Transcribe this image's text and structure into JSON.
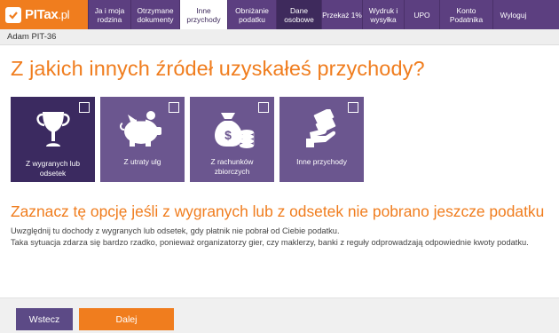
{
  "logo": {
    "text": "PITax",
    "suffix": ".pl"
  },
  "nav": [
    {
      "label": "Ja i moja rodzina",
      "width": 48
    },
    {
      "label": "Otrzymane dokumenty",
      "width": 55
    },
    {
      "label": "Inne przychody",
      "width": 54,
      "state": "active"
    },
    {
      "label": "Obniżanie podatku",
      "width": 55
    },
    {
      "label": "Dane osobowe",
      "width": 51,
      "state": "sel2"
    },
    {
      "label": "Przekaż 1%",
      "width": 46
    },
    {
      "label": "Wydruk i wysyłka",
      "width": 47
    },
    {
      "label": "UPO",
      "width": 40
    },
    {
      "label": "Konto Podatnika",
      "width": 60
    },
    {
      "label": "Wyloguj",
      "width": 46
    }
  ],
  "breadcrumb": "Adam PIT-36",
  "heading": "Z jakich innych źródeł uzyskałeś przychody?",
  "tiles": [
    {
      "label": "Z wygranych lub odsetek",
      "icon": "trophy-icon",
      "selected": true,
      "checked": false
    },
    {
      "label": "Z utraty ulg",
      "icon": "piggy-bank-icon",
      "selected": false,
      "checked": false
    },
    {
      "label": "Z rachunków zbiorczych",
      "icon": "money-bag-icon",
      "selected": false,
      "checked": false
    },
    {
      "label": "Inne przychody",
      "icon": "money-hand-icon",
      "selected": false,
      "checked": false
    }
  ],
  "info": {
    "heading": "Zaznacz tę opcję jeśli z wygranych lub z odsetek nie pobrano jeszcze podatku",
    "line1": "Uwzględnij tu dochody z wygranych lub odsetek, gdy płatnik nie pobrał od Ciebie podatku.",
    "line2": "Taka sytuacja zdarza się bardzo rzadko, ponieważ organizatorzy gier, czy maklerzy, banki z reguły odprowadzają odpowiednie kwoty podatku."
  },
  "buttons": {
    "back": "Wstecz",
    "next": "Dalej"
  },
  "colors": {
    "accent": "#f07d1e",
    "nav": "#5c3f80",
    "tile": "#6b568f",
    "tile_selected": "#3b2a60"
  }
}
